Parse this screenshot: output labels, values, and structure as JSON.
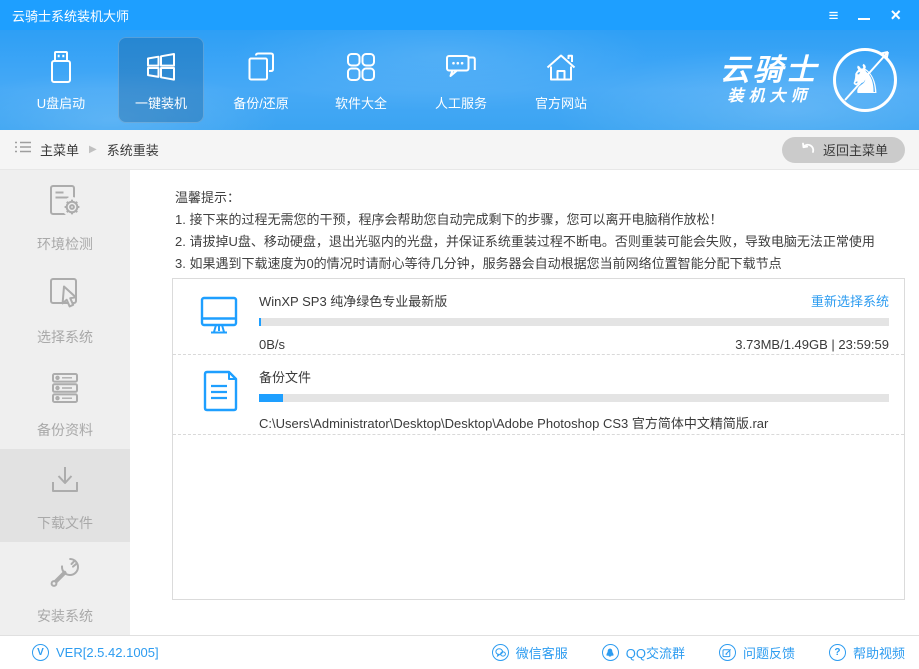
{
  "colors": {
    "titlebar": "#1E9FFF",
    "accent": "#1E9FFF",
    "link": "#2D9CF0",
    "nav_sky": "#3BA4F2",
    "sidebar_bg": "#EFEFEF",
    "sidebar_active_bg": "#E2E2E2",
    "progress_track": "#E4E4E4"
  },
  "titlebar": {
    "title": "云骑士系统装机大师",
    "controls": [
      {
        "name": "menu-icon",
        "glyph": "≡"
      },
      {
        "name": "minimize-icon",
        "glyph": "—"
      },
      {
        "name": "close-icon",
        "glyph": "×"
      }
    ]
  },
  "nav": {
    "active_index": 1,
    "items": [
      {
        "label": "U盘启动",
        "icon": "usb-drive-icon"
      },
      {
        "label": "一键装机",
        "icon": "windows-icon"
      },
      {
        "label": "备份/还原",
        "icon": "backup-restore-icon"
      },
      {
        "label": "软件大全",
        "icon": "software-grid-icon"
      },
      {
        "label": "人工服务",
        "icon": "chat-service-icon"
      },
      {
        "label": "官方网站",
        "icon": "home-website-icon"
      }
    ],
    "logo": {
      "line1": "云骑士",
      "line2": "装机大师",
      "emblem": "knight-horse-icon",
      "knight_glyph": "♞"
    }
  },
  "breadcrumb": {
    "items": [
      "主菜单",
      "系统重装"
    ],
    "arrow": "▶",
    "back_button": "返回主菜单"
  },
  "sidebar": {
    "active_index": 3,
    "items": [
      {
        "label": "环境检测",
        "icon": "env-check-icon"
      },
      {
        "label": "选择系统",
        "icon": "select-system-icon"
      },
      {
        "label": "备份资料",
        "icon": "backup-data-icon"
      },
      {
        "label": "下载文件",
        "icon": "download-file-icon"
      },
      {
        "label": "安装系统",
        "icon": "install-system-icon"
      }
    ]
  },
  "main": {
    "tips": {
      "title": "温馨提示：",
      "lines": [
        "1. 接下来的过程无需您的干预，程序会帮助您自动完成剩下的步骤，您可以离开电脑稍作放松！",
        "2. 请拔掉U盘、移动硬盘，退出光驱内的光盘，并保证系统重装过程不断电。否则重装可能会失败，导致电脑无法正常使用",
        "3. 如果遇到下载速度为0的情况时请耐心等待几分钟，服务器会自动根据您当前网络位置智能分配下载节点"
      ]
    },
    "downloads": [
      {
        "name": "WinXP SP3 纯净绿色专业最新版",
        "action": "重新选择系统",
        "speed": "0B/s",
        "stats": "3.73MB/1.49GB | 23:59:59",
        "progress_percent": 0.3,
        "icon": "monitor-icon"
      },
      {
        "name": "备份文件",
        "path": "C:\\Users\\Administrator\\Desktop\\Desktop\\Adobe Photoshop CS3 官方简体中文精简版.rar",
        "progress_percent": 3.8,
        "icon": "document-icon"
      }
    ]
  },
  "statusbar": {
    "version": "VER[2.5.42.1005]",
    "version_icon_glyph": "V",
    "links": [
      {
        "label": "微信客服",
        "icon": "wechat-icon"
      },
      {
        "label": "QQ交流群",
        "icon": "qq-icon"
      },
      {
        "label": "问题反馈",
        "icon": "feedback-icon"
      },
      {
        "label": "帮助视频",
        "icon": "help-icon",
        "glyph": "?"
      }
    ]
  }
}
